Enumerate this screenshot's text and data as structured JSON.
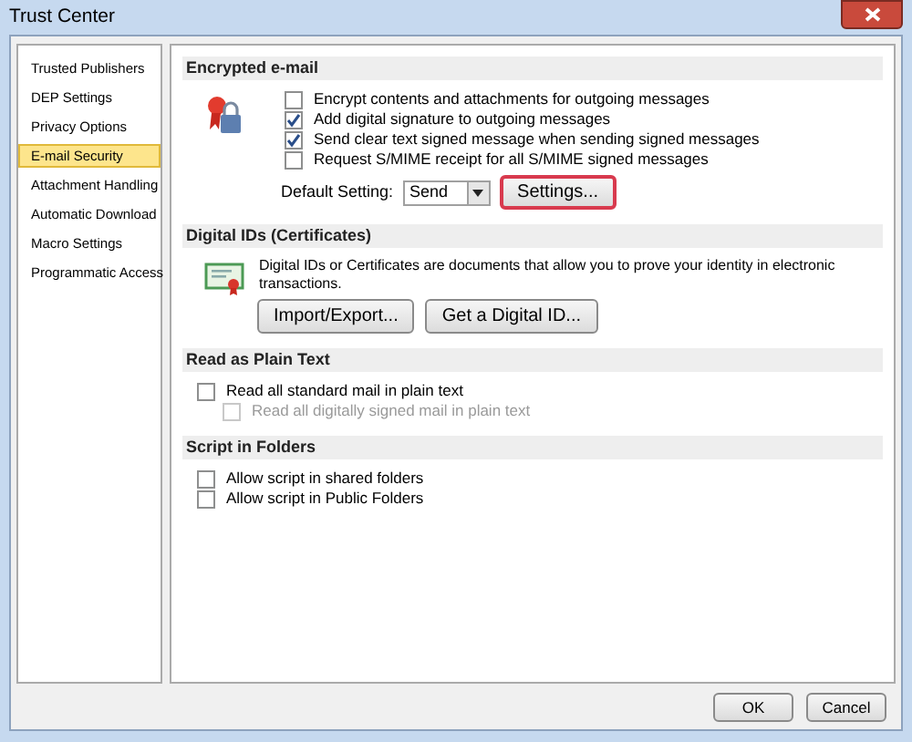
{
  "window": {
    "title": "Trust Center"
  },
  "sidebar": {
    "items": [
      {
        "label": "Trusted Publishers",
        "selected": false
      },
      {
        "label": "DEP Settings",
        "selected": false
      },
      {
        "label": "Privacy Options",
        "selected": false
      },
      {
        "label": "E-mail Security",
        "selected": true
      },
      {
        "label": "Attachment Handling",
        "selected": false
      },
      {
        "label": "Automatic Download",
        "selected": false
      },
      {
        "label": "Macro Settings",
        "selected": false
      },
      {
        "label": "Programmatic Access",
        "selected": false
      }
    ]
  },
  "sections": [
    {
      "title": "Encrypted e-mail",
      "checkboxes": [
        {
          "label": "Encrypt contents and attachments for outgoing messages",
          "checked": false,
          "disabled": false
        },
        {
          "label": "Add digital signature to outgoing messages",
          "checked": true,
          "disabled": false
        },
        {
          "label": "Send clear text signed message when sending signed messages",
          "checked": true,
          "disabled": false
        },
        {
          "label": "Request S/MIME receipt for all S/MIME signed messages",
          "checked": false,
          "disabled": false
        }
      ],
      "default_setting": {
        "label": "Default Setting:",
        "value": "Send",
        "button": {
          "label": "Settings...",
          "highlighted": true
        }
      }
    },
    {
      "title": "Digital IDs (Certificates)",
      "description": "Digital IDs or Certificates are documents that allow you to prove your identity in electronic transactions.",
      "buttons": [
        {
          "label": "Import/Export...",
          "highlighted": false
        },
        {
          "label": "Get a Digital ID...",
          "highlighted": false
        }
      ]
    },
    {
      "title": "Read as Plain Text",
      "checkboxes": [
        {
          "label": "Read all standard mail in plain text",
          "checked": false,
          "disabled": false,
          "children": [
            {
              "label": "Read all digitally signed mail in plain text",
              "checked": false,
              "disabled": true
            }
          ]
        }
      ]
    },
    {
      "title": "Script in Folders",
      "checkboxes": [
        {
          "label": "Allow script in shared folders",
          "checked": false,
          "disabled": false
        },
        {
          "label": "Allow script in Public Folders",
          "checked": false,
          "disabled": false
        }
      ]
    }
  ],
  "footer": {
    "buttons": [
      "OK",
      "Cancel"
    ]
  }
}
